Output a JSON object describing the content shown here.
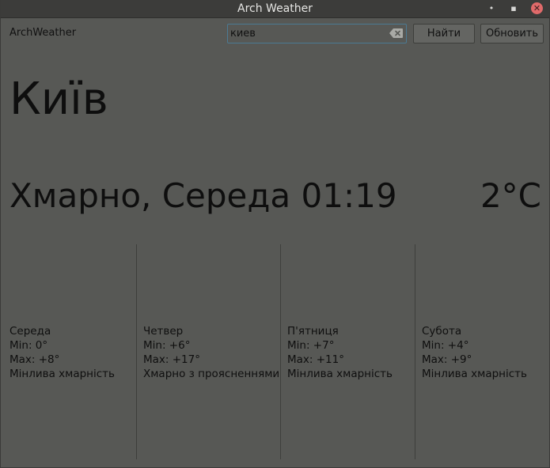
{
  "window": {
    "title": "Arch Weather",
    "minimize_glyph": "•",
    "maximize_glyph": "▪",
    "close_glyph": "✕"
  },
  "toolbar": {
    "app_name": "ArchWeather",
    "search_value": "киев",
    "find_label": "Найти",
    "refresh_label": "Обновить"
  },
  "current": {
    "city": "Київ",
    "conditions": "Хмарно, Середа 01:19",
    "temperature": "2°C"
  },
  "forecast": [
    {
      "day": "Середа",
      "min": "Min: 0°",
      "max": "Max: +8°",
      "description": "Мінлива хмарність"
    },
    {
      "day": "Четвер",
      "min": "Min: +6°",
      "max": "Max: +17°",
      "description": "Хмарно з проясненнями"
    },
    {
      "day": "П'ятниця",
      "min": "Min: +7°",
      "max": "Max: +11°",
      "description": "Мінлива хмарність"
    },
    {
      "day": "Субота",
      "min": "Min: +4°",
      "max": "Max: +9°",
      "description": "Мінлива хмарність"
    }
  ],
  "colors": {
    "window_bg": "#575855",
    "titlebar_bg": "#3c3c3a",
    "text": "#0e0e0e",
    "input_focus_border": "#4b7a93",
    "close_button": "#e06a6a"
  },
  "icons": {
    "clear": "clear-text-icon",
    "minimize": "minimize-icon",
    "maximize": "maximize-icon",
    "close": "close-icon"
  }
}
